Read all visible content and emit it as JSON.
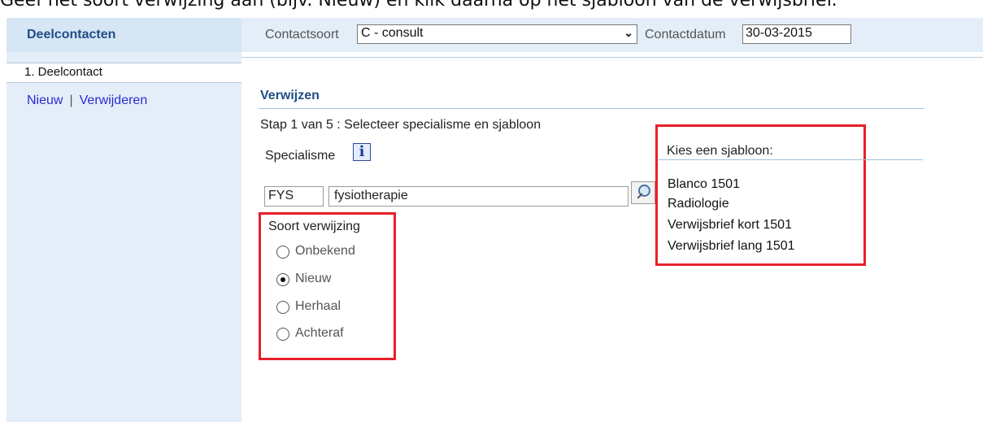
{
  "instruction": "Geef het soort verwijzing aan (bijv. Nieuw) en klik daarna op het sjabloon van de verwijsbrief.",
  "sidebar": {
    "title": "Deelcontacten",
    "tab": "1. Deelcontact",
    "actions": {
      "new": "Nieuw",
      "separator": "|",
      "delete": "Verwijderen"
    }
  },
  "header": {
    "contactsoort_label": "Contactsoort",
    "contactsoort_value": "C - consult",
    "contactdatum_label": "Contactdatum",
    "contactdatum_value": "30-03-2015"
  },
  "main": {
    "title": "Verwijzen",
    "step": "Stap 1 van 5 : Selecteer specialisme en sjabloon",
    "specialisme_label": "Specialisme",
    "specialisme_code": "FYS",
    "specialisme_desc": "fysiotherapie",
    "soort_label": "Soort verwijzing",
    "soort_options": [
      {
        "label": "Onbekend",
        "selected": false
      },
      {
        "label": "Nieuw",
        "selected": true
      },
      {
        "label": "Herhaal",
        "selected": false
      },
      {
        "label": "Achteraf",
        "selected": false
      }
    ],
    "sjabloon_label": "Kies een sjabloon:",
    "sjablonen": [
      "Blanco 1501",
      "Radiologie",
      "Verwijsbrief kort 1501",
      "Verwijsbrief lang 1501"
    ]
  },
  "colors": {
    "highlight": "#e8202a",
    "title": "#1f4e86",
    "panel": "#e3eef8"
  }
}
